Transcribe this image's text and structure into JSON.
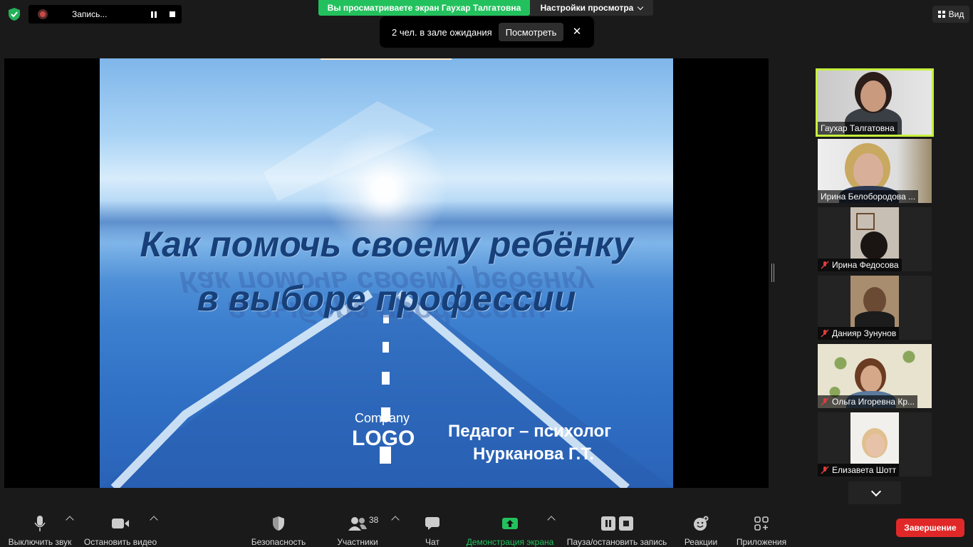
{
  "recording": {
    "label": "Запись..."
  },
  "banner": {
    "sharing_text": "Вы просматриваете экран Гаухар Талгатовна",
    "view_settings": "Настройки просмотра"
  },
  "waiting_room": {
    "text": "2 чел. в зале ожидания",
    "view_button": "Посмотреть",
    "close": "✕"
  },
  "view_menu": {
    "label": "Вид"
  },
  "slide": {
    "title_line1": "Как помочь своему ребёнку",
    "title_line2": "в выборе профессии",
    "company": "Company",
    "logo": "LOGO",
    "author_line1": "Педагог – психолог",
    "author_line2": "Нурканова Г.Т."
  },
  "participants": [
    {
      "name": "Гаухар Талгатовна",
      "muted": false,
      "active": true
    },
    {
      "name": "Ирина Белобородова ...",
      "muted": false,
      "active": false
    },
    {
      "name": "Ирина Федосова",
      "muted": true,
      "active": false
    },
    {
      "name": "Данияр Зунунов",
      "muted": true,
      "active": false
    },
    {
      "name": "Ольга  Игоревна Кр...",
      "muted": true,
      "active": false
    },
    {
      "name": "Елизавета Шотт",
      "muted": true,
      "active": false
    }
  ],
  "toolbar": {
    "mute": "Выключить звук",
    "video": "Остановить видео",
    "security": "Безопасность",
    "participants": "Участники",
    "participants_count": "38",
    "chat": "Чат",
    "share": "Демонстрация экрана",
    "record": "Пауза/остановить запись",
    "reactions": "Реакции",
    "apps": "Приложения",
    "end": "Завершение"
  },
  "colors": {
    "share_green": "#23c15d",
    "active_speaker": "#c6f03e",
    "end_red": "#e02828"
  }
}
